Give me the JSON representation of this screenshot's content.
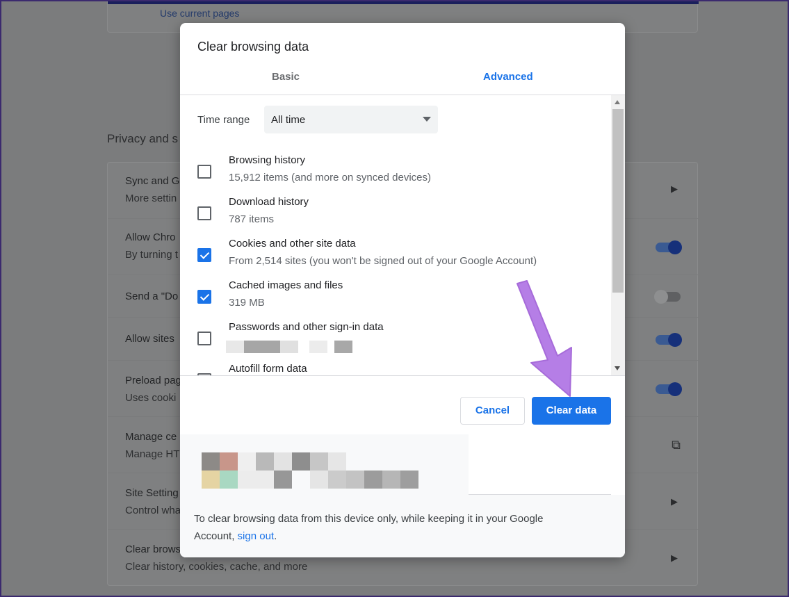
{
  "background": {
    "top_link": "Use current pages",
    "section_heading": "Privacy and s",
    "rows": [
      {
        "title": "Sync and G",
        "subtitle": "More settin"
      },
      {
        "title": "Allow Chro",
        "subtitle": "By turning t"
      },
      {
        "title": "Send a \"Do",
        "subtitle": ""
      },
      {
        "title": "Allow sites",
        "subtitle": ""
      },
      {
        "title": "Preload pag",
        "subtitle": "Uses cooki"
      },
      {
        "title": "Manage ce",
        "subtitle": "Manage HT"
      },
      {
        "title": "Site Setting",
        "subtitle": "Control wha"
      },
      {
        "title": "Clear brows",
        "subtitle": "Clear history, cookies, cache, and more"
      }
    ]
  },
  "dialog": {
    "title": "Clear browsing data",
    "tabs": [
      {
        "label": "Basic",
        "active": false
      },
      {
        "label": "Advanced",
        "active": true
      }
    ],
    "time_range": {
      "label": "Time range",
      "value": "All time"
    },
    "items": [
      {
        "label": "Browsing history",
        "sub": "15,912 items (and more on synced devices)",
        "checked": false
      },
      {
        "label": "Download history",
        "sub": "787 items",
        "checked": false
      },
      {
        "label": "Cookies and other site data",
        "sub": "From 2,514 sites (you won't be signed out of your Google Account)",
        "checked": true
      },
      {
        "label": "Cached images and files",
        "sub": "319 MB",
        "checked": true
      },
      {
        "label": "Passwords and other sign-in data",
        "sub": "",
        "checked": false
      },
      {
        "label": "Autofill form data",
        "sub": "",
        "checked": false
      }
    ],
    "buttons": {
      "cancel": "Cancel",
      "clear": "Clear data"
    },
    "footer": {
      "text_before": "To clear browsing data from this device only, while keeping it in your Google Account, ",
      "link": "sign out",
      "text_after": "."
    }
  },
  "colors": {
    "accent": "#1a73e8",
    "annotation_arrow": "#b57ee6"
  }
}
